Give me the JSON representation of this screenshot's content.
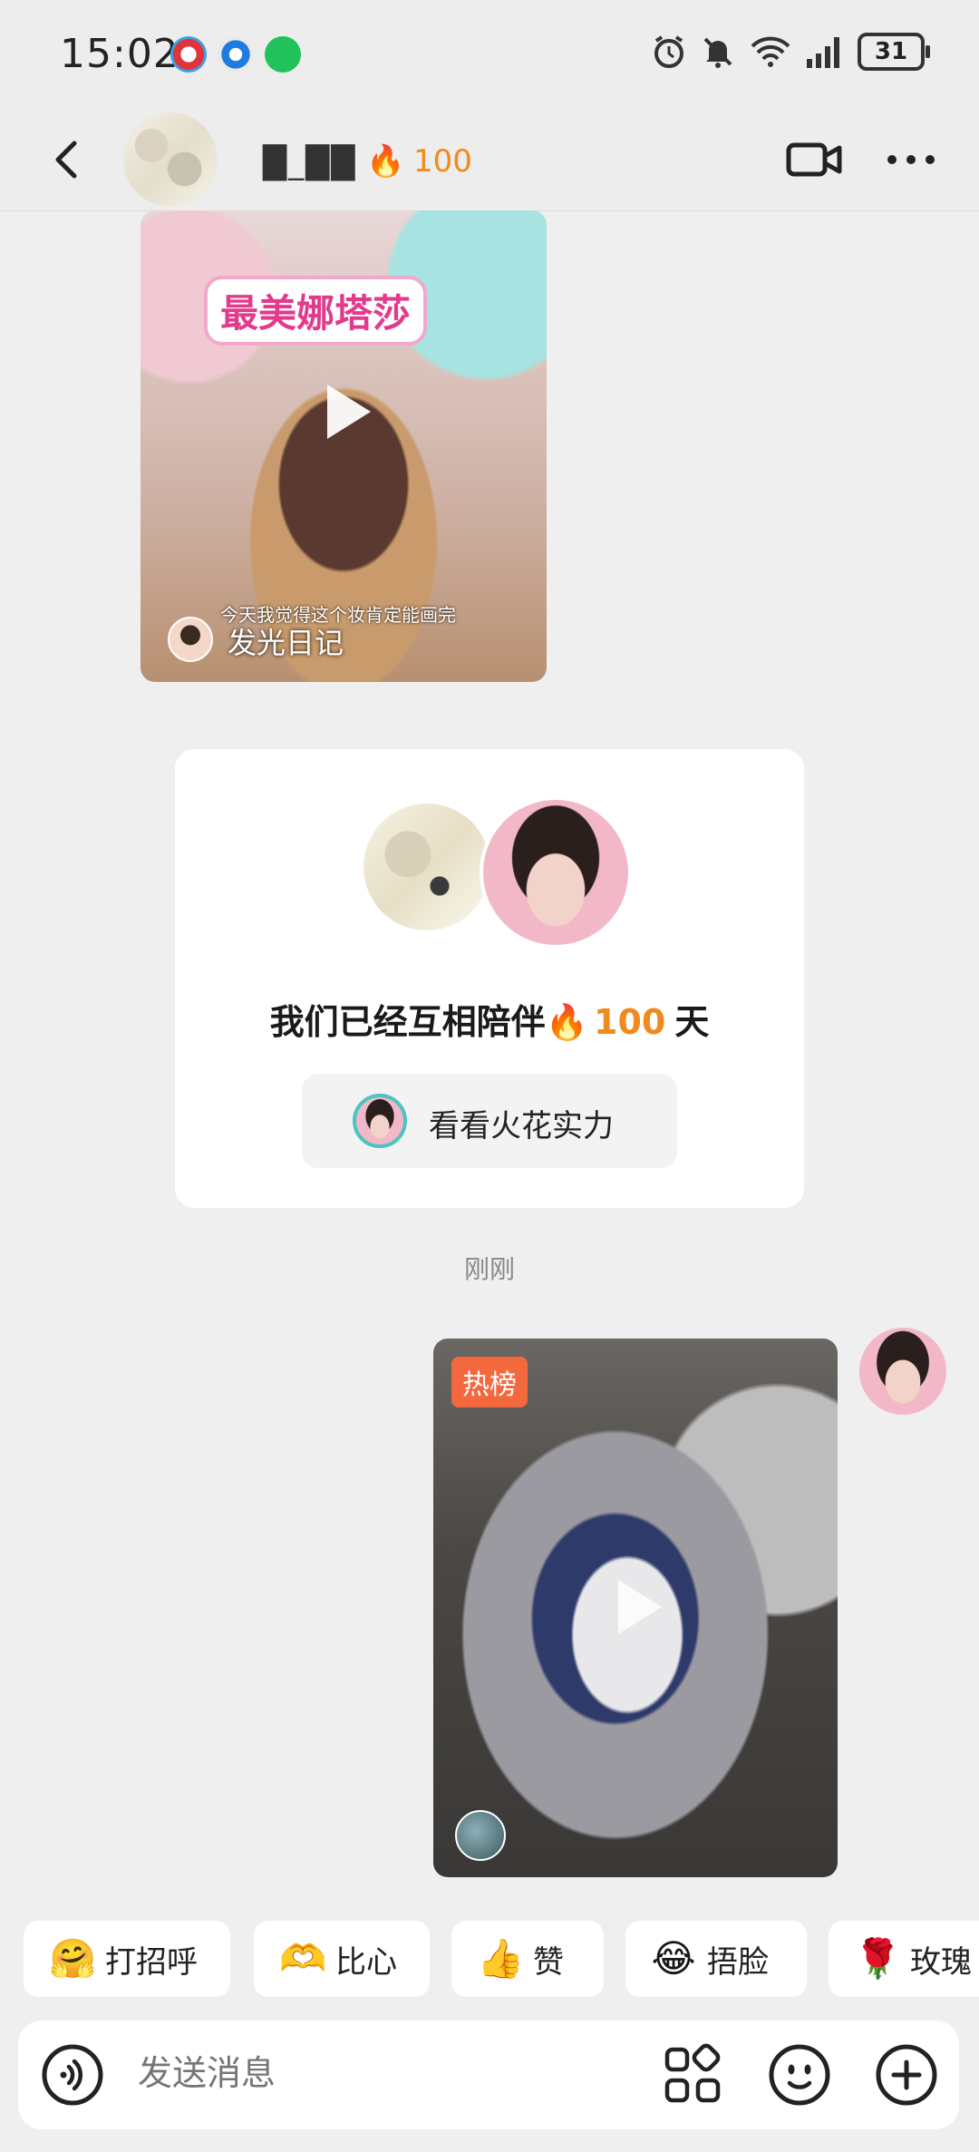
{
  "status_bar": {
    "time": "15:02",
    "battery": "31"
  },
  "header": {
    "contact_name": "█_██",
    "streak_fire": "🔥",
    "streak_days": "100"
  },
  "shared_video": {
    "overlay_title": "最美娜塔莎",
    "caption": "今天我觉得这个妆肯定能画完",
    "author": "发光日记"
  },
  "streak_card": {
    "text_before": "我们已经互相陪伴",
    "fire": "🔥",
    "days": "100",
    "text_after": "天",
    "button_label": "看看火花实力"
  },
  "timestamp": "刚刚",
  "sent_video": {
    "badge": "热榜"
  },
  "quick_replies": [
    {
      "emoji": "🤗",
      "label": "打招呼"
    },
    {
      "emoji": "🫶",
      "label": "比心"
    },
    {
      "emoji": "👍",
      "label": "赞"
    },
    {
      "emoji": "😂",
      "label": "捂脸"
    },
    {
      "emoji": "🌹",
      "label": "玫瑰"
    }
  ],
  "input": {
    "placeholder": "发送消息"
  },
  "colors": {
    "accent_orange": "#f08a1c",
    "hot_badge": "#f4683d",
    "background": "#efefef"
  }
}
